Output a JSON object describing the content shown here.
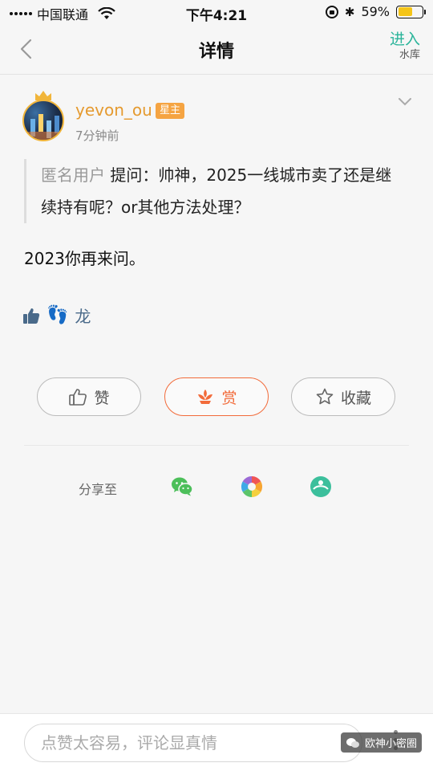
{
  "status_bar": {
    "carrier": "中国联通",
    "time": "下午4:21",
    "battery": "59%",
    "battery_level": 0.59
  },
  "nav": {
    "title": "详情",
    "enter_label": "进入",
    "enter_sub": "水库"
  },
  "post": {
    "username": "yevon_ou",
    "badge": "星主",
    "time": "7分钟前",
    "question_author": "匿名用户",
    "question_text": " 提问：帅神，2025一线城市卖了还是继续持有呢？or其他方法处理？",
    "answer": "2023你再来问。",
    "liker": "龙",
    "feet_emoji": "👣"
  },
  "actions": {
    "like": "赞",
    "reward": "赏",
    "collect": "收藏"
  },
  "share": {
    "label": "分享至"
  },
  "bottom": {
    "comment_placeholder": "点赞太容易，评论显真情",
    "watermark": "欧神小密圈"
  },
  "colors": {
    "accent_teal": "#2ab49a",
    "username_orange": "#e59a2f",
    "reward_red": "#f26b3a"
  }
}
